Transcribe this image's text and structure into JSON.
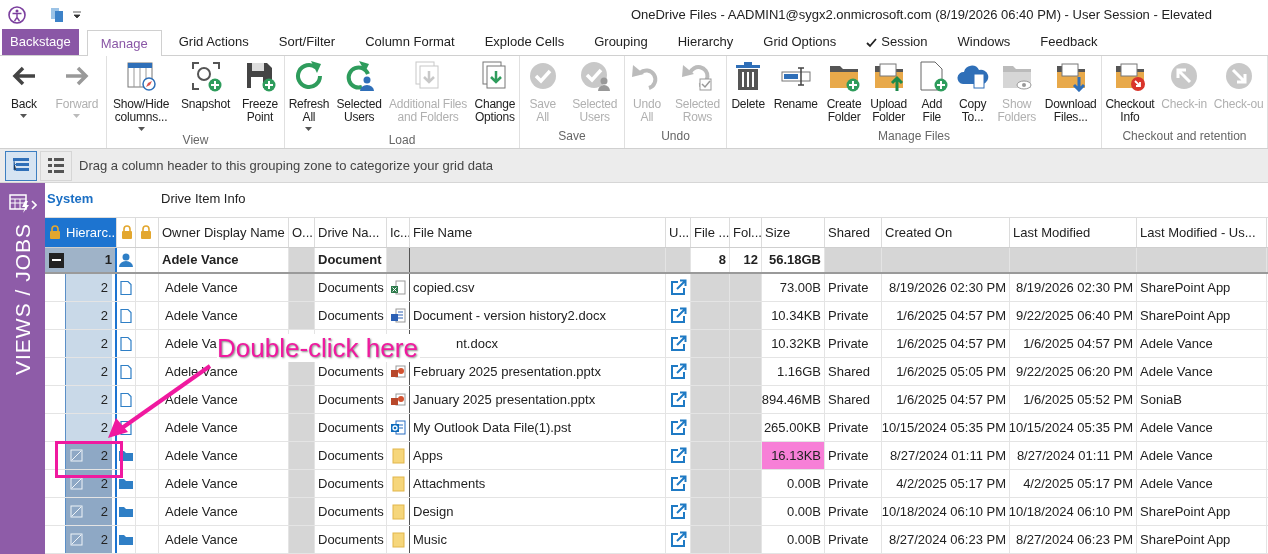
{
  "title_bar": {
    "title": "OneDrive Files - AADMIN1@sygx2.onmicrosoft.com (8/19/2026 06:40 PM) - User Session - Elevated"
  },
  "tabs": [
    {
      "label": "Backstage",
      "kind": "backstage",
      "selected": false,
      "checked": false
    },
    {
      "label": "Manage",
      "kind": "tab",
      "selected": true,
      "checked": false
    },
    {
      "label": "Grid Actions",
      "kind": "tab",
      "selected": false,
      "checked": false
    },
    {
      "label": "Sort/Filter",
      "kind": "tab",
      "selected": false,
      "checked": false
    },
    {
      "label": "Column Format",
      "kind": "tab",
      "selected": false,
      "checked": false
    },
    {
      "label": "Explode Cells",
      "kind": "tab",
      "selected": false,
      "checked": false
    },
    {
      "label": "Grouping",
      "kind": "tab",
      "selected": false,
      "checked": false
    },
    {
      "label": "Hierarchy",
      "kind": "tab",
      "selected": false,
      "checked": false
    },
    {
      "label": "Grid Options",
      "kind": "tab",
      "selected": false,
      "checked": false
    },
    {
      "label": "Session",
      "kind": "tab",
      "selected": false,
      "checked": true
    },
    {
      "label": "Windows",
      "kind": "tab",
      "selected": false,
      "checked": false
    },
    {
      "label": "Feedback",
      "kind": "tab",
      "selected": false,
      "checked": false
    }
  ],
  "ribbon": {
    "groups": [
      {
        "buttons": [
          {
            "lines": [
              "Back"
            ],
            "kind": "back",
            "dropdown": true,
            "disabled": false
          },
          {
            "lines": [
              "Forward"
            ],
            "kind": "forward",
            "dropdown": true,
            "disabled": true
          }
        ]
      },
      {
        "label": "View",
        "buttons": [
          {
            "lines": [
              "Show/Hide",
              "columns..."
            ],
            "kind": "columns",
            "dropdown": true,
            "disabled": false
          },
          {
            "lines": [
              "Snapshot"
            ],
            "kind": "snapshot",
            "dropdown": false,
            "disabled": false
          },
          {
            "lines": [
              "Freeze",
              "Point"
            ],
            "kind": "freeze",
            "dropdown": false,
            "disabled": false
          }
        ]
      },
      {
        "label": "Load",
        "buttons": [
          {
            "lines": [
              "Refresh",
              "All"
            ],
            "kind": "refresh",
            "dropdown": true,
            "disabled": false
          },
          {
            "lines": [
              "Selected",
              "Users"
            ],
            "kind": "users",
            "dropdown": false,
            "disabled": false
          },
          {
            "lines": [
              "Additional Files",
              "and Folders"
            ],
            "kind": "additional",
            "dropdown": false,
            "disabled": true
          },
          {
            "lines": [
              "Change",
              "Options"
            ],
            "kind": "options",
            "dropdown": false,
            "disabled": false
          }
        ]
      },
      {
        "label": "Save",
        "buttons": [
          {
            "lines": [
              "Save",
              "All"
            ],
            "kind": "save",
            "dropdown": false,
            "disabled": true
          },
          {
            "lines": [
              "Selected",
              "Users"
            ],
            "kind": "saveusers",
            "dropdown": false,
            "disabled": true
          }
        ]
      },
      {
        "label": "Undo",
        "buttons": [
          {
            "lines": [
              "Undo",
              "All"
            ],
            "kind": "undo",
            "dropdown": false,
            "disabled": true
          },
          {
            "lines": [
              "Selected",
              "Rows"
            ],
            "kind": "undorows",
            "dropdown": false,
            "disabled": true
          }
        ]
      },
      {
        "label": "Manage Files",
        "buttons": [
          {
            "lines": [
              "Delete"
            ],
            "kind": "delete",
            "dropdown": false,
            "disabled": false
          },
          {
            "lines": [
              "Rename"
            ],
            "kind": "rename",
            "dropdown": false,
            "disabled": false
          },
          {
            "lines": [
              "Create",
              "Folder"
            ],
            "kind": "create",
            "dropdown": false,
            "disabled": false
          },
          {
            "lines": [
              "Upload",
              "Folder"
            ],
            "kind": "upload",
            "dropdown": false,
            "disabled": false
          },
          {
            "lines": [
              "Add",
              "File"
            ],
            "kind": "add",
            "dropdown": false,
            "disabled": false
          },
          {
            "lines": [
              "Copy",
              "To..."
            ],
            "kind": "copy",
            "dropdown": false,
            "disabled": false
          },
          {
            "lines": [
              "Show",
              "Folders"
            ],
            "kind": "show",
            "dropdown": false,
            "disabled": true
          },
          {
            "lines": [
              "Download",
              "Files..."
            ],
            "kind": "download",
            "dropdown": false,
            "disabled": false
          }
        ]
      },
      {
        "label": "Checkout and retention",
        "buttons": [
          {
            "lines": [
              "Checkout",
              "Info"
            ],
            "kind": "checkout",
            "dropdown": false,
            "disabled": false
          },
          {
            "lines": [
              "Check-in"
            ],
            "kind": "checkin",
            "dropdown": false,
            "disabled": true
          },
          {
            "lines": [
              "Check-ou"
            ],
            "kind": "checkoutfile",
            "dropdown": false,
            "disabled": true
          }
        ]
      }
    ]
  },
  "grouping_bar": {
    "views": [
      {
        "kind": "tree",
        "selected": true
      },
      {
        "kind": "list",
        "selected": false
      }
    ],
    "hint": "Drag a column header to this grouping zone to categorize your grid data"
  },
  "sidebar": {
    "label": "VIEWS / JOBS"
  },
  "grid": {
    "bands": [
      {
        "label": "System",
        "selected": true
      },
      {
        "label": "Drive Item Info",
        "selected": false
      }
    ],
    "columns": [
      {
        "label": "Hierarc...",
        "locked": true,
        "selected": true
      },
      {
        "locked": true,
        "selected": false
      },
      {
        "locked": true,
        "selected": false
      },
      {
        "label": "Owner Display Name",
        "locked": false,
        "selected": false
      },
      {
        "label": "O...",
        "locked": false,
        "selected": false
      },
      {
        "label": "Drive Na...",
        "locked": false,
        "selected": false
      },
      {
        "label": "Ic...",
        "locked": false,
        "selected": false
      },
      {
        "label": "File Name",
        "locked": false,
        "selected": false
      },
      {
        "label": "U...",
        "locked": false,
        "selected": false
      },
      {
        "label": "File ...",
        "locked": false,
        "selected": false
      },
      {
        "label": "Fol...",
        "locked": false,
        "selected": false
      },
      {
        "label": "Size",
        "locked": false,
        "selected": false
      },
      {
        "label": "Shared",
        "locked": false,
        "selected": false
      },
      {
        "label": "Created On",
        "locked": false,
        "selected": false
      },
      {
        "label": "Last Modified",
        "locked": false,
        "selected": false
      },
      {
        "label": "Last Modified - Us...",
        "locked": false,
        "selected": false
      }
    ],
    "group_row": {
      "hierarchy": "1",
      "expanded": true,
      "owner": "Adele Vance",
      "drive": "Document",
      "files": "8",
      "folders": "12",
      "size": "56.18GB"
    },
    "rows": [
      {
        "kind": "spreadsheet",
        "hierarchy": "2",
        "owner": "Adele Vance",
        "drive": "Documents",
        "file_name": "copied.csv",
        "size": "73.00B",
        "shared": "Private",
        "created": "8/19/2026 02:30 PM",
        "modified": "8/19/2026 02:30 PM",
        "modified_by": "SharePoint App",
        "highlighted": false,
        "covered": false
      },
      {
        "kind": "word",
        "hierarchy": "2",
        "owner": "Adele Vance",
        "drive": "Documents",
        "file_name": "Document - version history2.docx",
        "size": "10.34KB",
        "shared": "Private",
        "created": "1/6/2025 04:57 PM",
        "modified": "9/22/2025 06:40 PM",
        "modified_by": "SharePoint App",
        "highlighted": false,
        "covered": false
      },
      {
        "kind": "word",
        "hierarchy": "2",
        "owner": "Adele Va",
        "file_name": "nt.docx",
        "size": "10.32KB",
        "shared": "Private",
        "created": "1/6/2025 04:57 PM",
        "modified": "1/6/2025 04:57 PM",
        "modified_by": "Adele Vance",
        "highlighted": false,
        "covered": true
      },
      {
        "kind": "slides",
        "hierarchy": "2",
        "owner": "Adele Vance",
        "drive": "Documents",
        "file_name": "February 2025 presentation.pptx",
        "size": "1.16GB",
        "shared": "Shared",
        "created": "1/6/2025 05:05 PM",
        "modified": "9/22/2025 06:20 PM",
        "modified_by": "Adele Vance",
        "highlighted": false,
        "covered": false
      },
      {
        "kind": "slides",
        "hierarchy": "2",
        "owner": "Adele Vance",
        "drive": "Documents",
        "file_name": "January 2025 presentation.pptx",
        "size": "894.46MB",
        "shared": "Shared",
        "created": "1/6/2025 04:57 PM",
        "modified": "1/6/2025 05:52 PM",
        "modified_by": "SoniaB",
        "highlighted": false,
        "covered": false
      },
      {
        "kind": "outlook",
        "hierarchy": "2",
        "owner": "Adele Vance",
        "drive": "Documents",
        "file_name": "My Outlook Data File(1).pst",
        "size": "265.00KB",
        "shared": "Private",
        "created": "10/15/2024 05:35 PM",
        "modified": "10/15/2024 05:35 PM",
        "modified_by": "Adele Vance",
        "highlighted": false,
        "covered": false
      },
      {
        "kind": "folder",
        "hierarchy": "2",
        "owner": "Adele Vance",
        "drive": "Documents",
        "file_name": "Apps",
        "size": "16.13KB",
        "shared": "Private",
        "created": "8/27/2024 01:11 PM",
        "modified": "8/27/2024 01:11 PM",
        "modified_by": "Adele Vance",
        "highlighted": true,
        "covered": false
      },
      {
        "kind": "folder",
        "hierarchy": "2",
        "owner": "Adele Vance",
        "drive": "Documents",
        "file_name": "Attachments",
        "size": "0.00B",
        "shared": "Private",
        "created": "4/2/2025 05:17 PM",
        "modified": "4/2/2025 05:17 PM",
        "modified_by": "Adele Vance",
        "highlighted": false,
        "covered": false
      },
      {
        "kind": "folder",
        "hierarchy": "2",
        "owner": "Adele Vance",
        "drive": "Documents",
        "file_name": "Design",
        "size": "0.00B",
        "shared": "Private",
        "created": "10/18/2024 06:10 PM",
        "modified": "10/18/2024 06:10 PM",
        "modified_by": "SharePoint App",
        "highlighted": false,
        "covered": false
      },
      {
        "kind": "folder",
        "hierarchy": "2",
        "owner": "Adele Vance",
        "drive": "Documents",
        "file_name": "Music",
        "size": "0.00B",
        "shared": "Private",
        "created": "8/27/2024 06:23 PM",
        "modified": "8/27/2024 06:23 PM",
        "modified_by": "SharePoint App",
        "highlighted": false,
        "covered": false
      }
    ]
  },
  "annotation": {
    "text": "Double-click here"
  }
}
